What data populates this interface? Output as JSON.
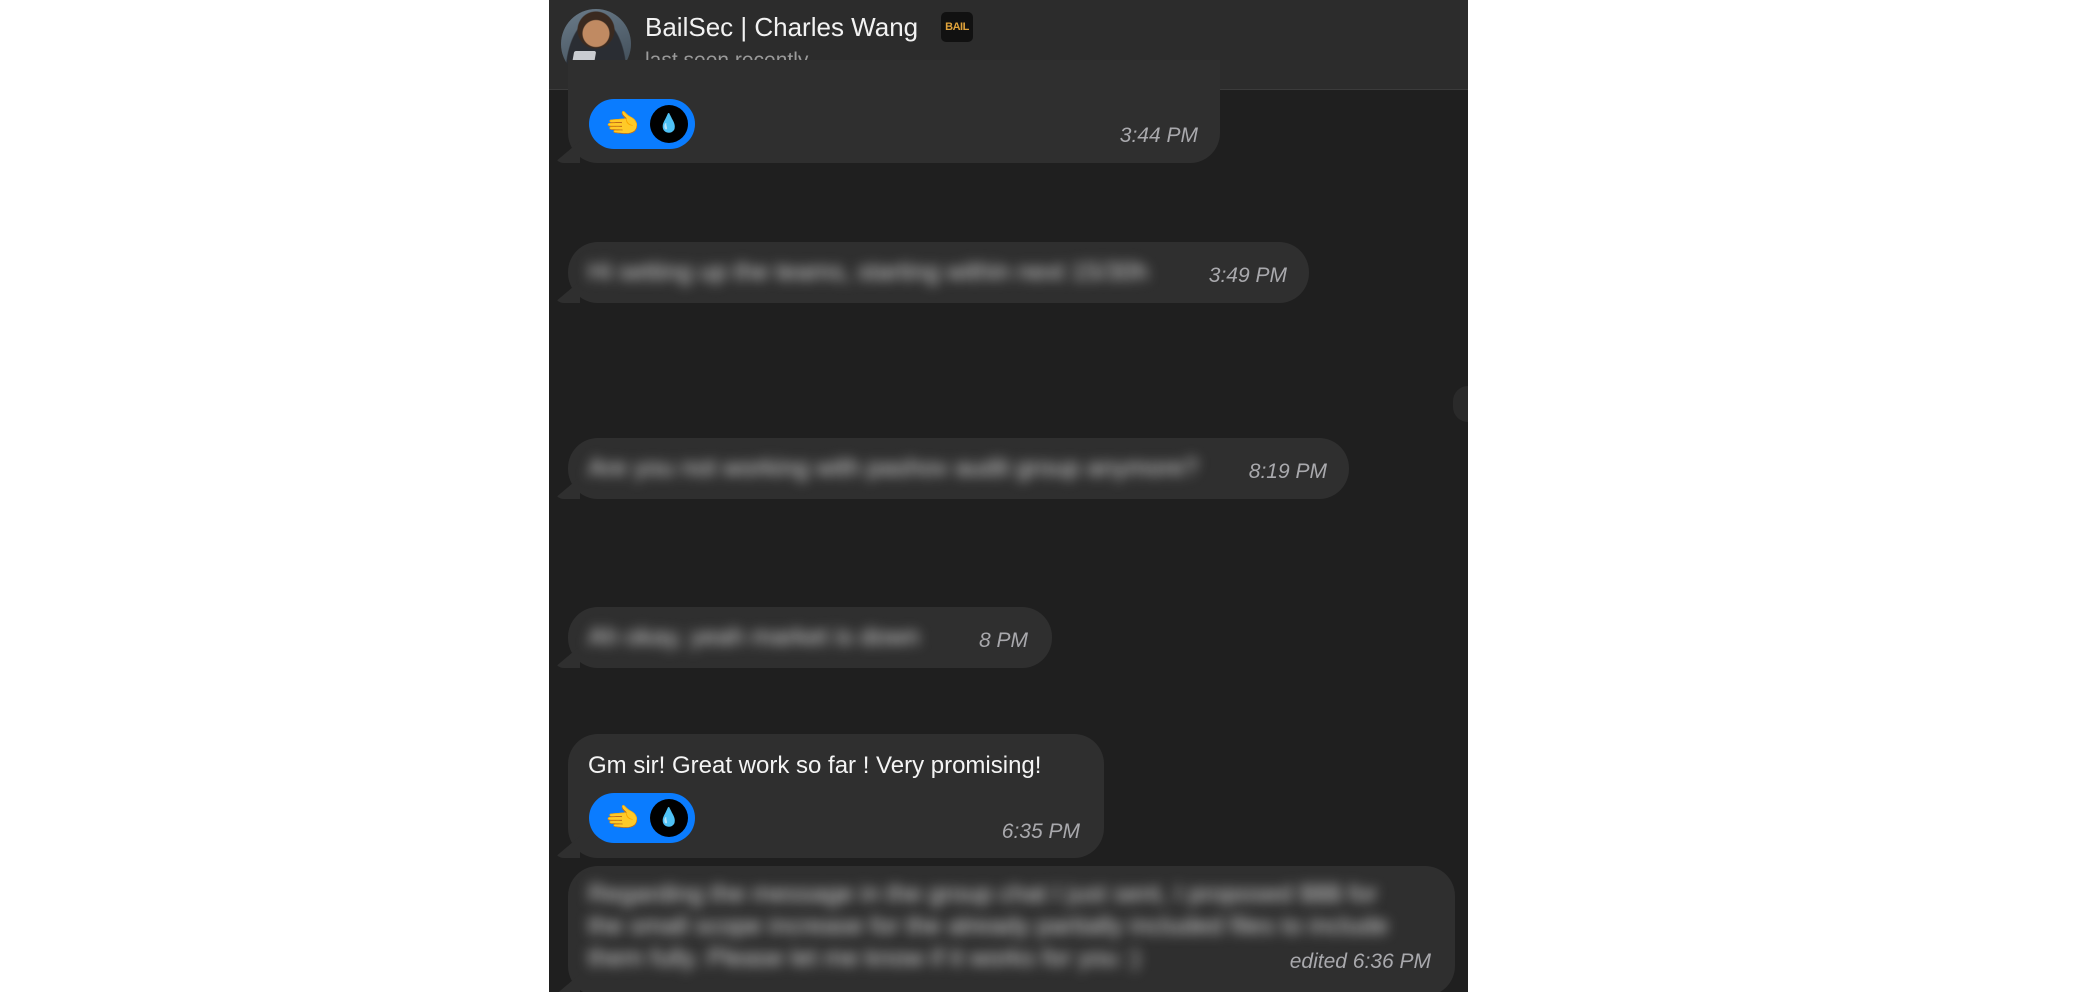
{
  "header": {
    "name": "BailSec | Charles Wang",
    "badge": "BAIL",
    "status": "last seen recently"
  },
  "messages": [
    {
      "id": "m1",
      "time": "3:44 PM",
      "reaction": {
        "emoji": "🫲",
        "icon": "drop-icon"
      }
    },
    {
      "id": "m2",
      "text": "Hi setting up the teams, starting within next 15/30h",
      "time": "3:49 PM",
      "blurred": true
    },
    {
      "id": "m3",
      "text": "Are you not working with pashov audit group anymore?",
      "time": "8:19 PM",
      "blurred": true
    },
    {
      "id": "m4",
      "text": "Ah okay, yeah market is down",
      "time": "8 PM",
      "blurred": true
    },
    {
      "id": "m5",
      "text": "Gm sir! Great work so far ! Very promising!",
      "time": "6:35 PM",
      "reaction": {
        "emoji": "🫲",
        "icon": "drop-icon"
      }
    },
    {
      "id": "m6",
      "text_line1": "Regarding the message in the group chat I just sent, I proposed $$$ for",
      "text_line2": "the small scope increase for the already partially included files to include",
      "text_line3": "them fully. Please let me know if it works for you :)",
      "time": "edited 6:36 PM",
      "blurred": true
    }
  ]
}
